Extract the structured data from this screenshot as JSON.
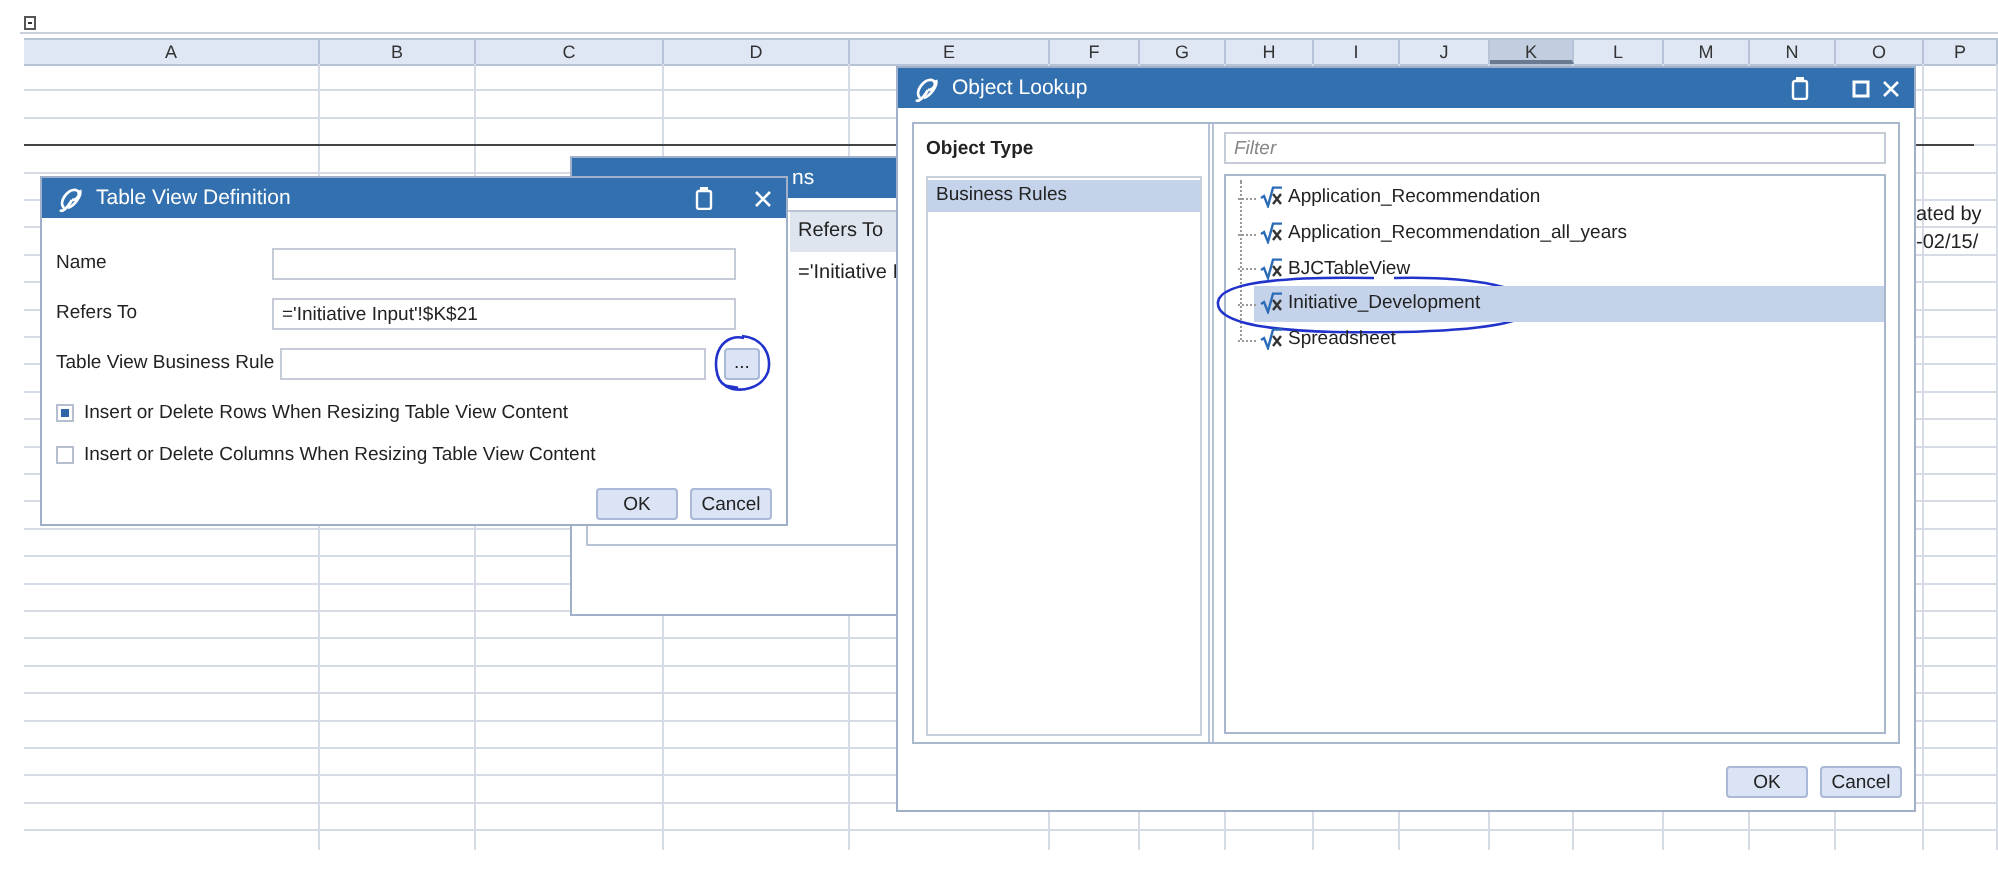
{
  "spreadsheet": {
    "columns": [
      {
        "label": "A",
        "selected": false
      },
      {
        "label": "B",
        "selected": false
      },
      {
        "label": "C",
        "selected": false
      },
      {
        "label": "D",
        "selected": false
      },
      {
        "label": "E",
        "selected": false
      },
      {
        "label": "F",
        "selected": false
      },
      {
        "label": "G",
        "selected": false
      },
      {
        "label": "H",
        "selected": false
      },
      {
        "label": "I",
        "selected": false
      },
      {
        "label": "J",
        "selected": false
      },
      {
        "label": "K",
        "selected": true
      },
      {
        "label": "L",
        "selected": false
      },
      {
        "label": "M",
        "selected": false
      },
      {
        "label": "N",
        "selected": false
      },
      {
        "label": "O",
        "selected": false
      },
      {
        "label": "P",
        "selected": false
      }
    ],
    "cells": [
      {
        "text": "ated by"
      },
      {
        "text": "-02/15/"
      }
    ]
  },
  "table_view_definitions": {
    "title": "ns",
    "column_header": "Refers To",
    "cell": "='Initiative I"
  },
  "table_view_definition": {
    "title": "Table View Definition",
    "fields": [
      {
        "kind": "text",
        "label": "Name"
      },
      {
        "kind": "text",
        "label": "Refers To",
        "value": "='Initiative Input'!$K$21"
      },
      {
        "kind": "browse",
        "label": "Table View Business Rule",
        "button": "...",
        "circled": true
      }
    ],
    "checkboxes": [
      {
        "label": "Insert or Delete Rows When Resizing Table View Content",
        "checked": true
      },
      {
        "label": "Insert or Delete Columns When Resizing Table View Content",
        "checked": false
      }
    ],
    "buttons": [
      "OK",
      "Cancel"
    ]
  },
  "object_lookup": {
    "title": "Object Lookup",
    "object_type_header": "Object Type",
    "object_types": [
      {
        "label": "Business Rules",
        "selected": true
      }
    ],
    "filter": {
      "placeholder": "Filter"
    },
    "objects": [
      {
        "label": "Application_Recommendation",
        "selected": false,
        "circled": false
      },
      {
        "label": "Application_Recommendation_all_years",
        "selected": false,
        "circled": false
      },
      {
        "label": "BJCTableView",
        "selected": false,
        "circled": false
      },
      {
        "label": "Initiative_Development",
        "selected": true,
        "circled": true
      },
      {
        "label": "Spreadsheet",
        "selected": false,
        "circled": false
      }
    ],
    "buttons": [
      "OK",
      "Cancel"
    ]
  }
}
